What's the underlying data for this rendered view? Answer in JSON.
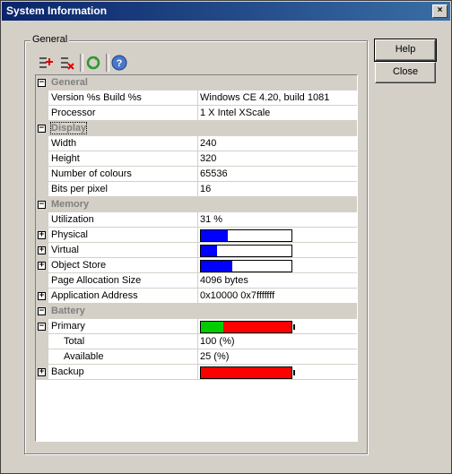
{
  "window": {
    "title": "System Information",
    "close_glyph": "×"
  },
  "group": {
    "label": "General"
  },
  "buttons": {
    "help": "Help",
    "close": "Close"
  },
  "toolbar": [
    {
      "icon": "expand-all-icon"
    },
    {
      "icon": "collapse-all-icon"
    },
    {
      "icon": "refresh-icon"
    },
    {
      "icon": "help-icon"
    }
  ],
  "colors": {
    "bar_fill": "#0000ff",
    "battery_full": "#00cc00",
    "battery_empty": "#ff0000"
  },
  "rows": [
    {
      "type": "cat",
      "label": "General",
      "expander": "−"
    },
    {
      "label": "Version %s Build %s",
      "value": "Windows CE 4.20, build 1081"
    },
    {
      "label": "Processor",
      "value": "1 X Intel XScale"
    },
    {
      "type": "cat",
      "label": "Display",
      "expander": "−"
    },
    {
      "label": "Width",
      "value": "240"
    },
    {
      "label": "Height",
      "value": "320"
    },
    {
      "label": "Number of colours",
      "value": "65536"
    },
    {
      "label": "Bits per pixel",
      "value": "16"
    },
    {
      "type": "cat",
      "label": "Memory",
      "expander": "−"
    },
    {
      "label": "Utilization",
      "value": "31 %"
    },
    {
      "label": "Physical",
      "expander": "+",
      "bar": 0.3
    },
    {
      "label": "Virtual",
      "expander": "+",
      "bar": 0.18
    },
    {
      "label": "Object Store",
      "expander": "+",
      "bar": 0.35
    },
    {
      "label": "Page Allocation Size",
      "value": "4096 bytes"
    },
    {
      "label": "Application Address",
      "expander": "+",
      "value": "0x10000 0x7fffffff"
    },
    {
      "type": "cat",
      "label": "Battery",
      "expander": "−"
    },
    {
      "label": "Primary",
      "expander": "−",
      "battery": 0.25
    },
    {
      "label": "Total",
      "indent": 1,
      "value": "100 (%)"
    },
    {
      "label": "Available",
      "indent": 1,
      "value": "25 (%)"
    },
    {
      "label": "Backup",
      "expander": "+",
      "battery": 0
    }
  ]
}
